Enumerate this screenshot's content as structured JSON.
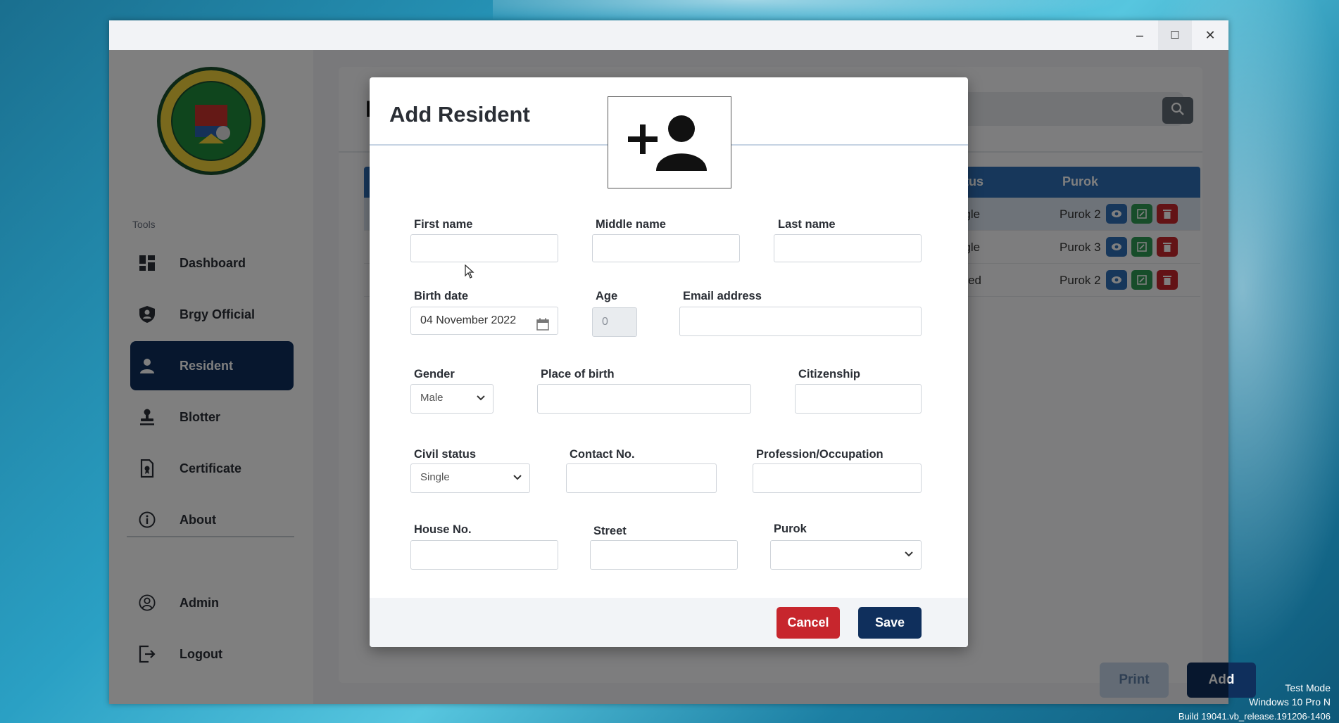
{
  "window": {
    "minimize_label": "–",
    "maximize_label": "☐",
    "close_label": "✕"
  },
  "sidebar": {
    "tools_label": "Tools",
    "items": [
      {
        "label": "Dashboard",
        "icon": "dashboard-icon"
      },
      {
        "label": "Brgy Official",
        "icon": "shield-user-icon"
      },
      {
        "label": "Resident",
        "icon": "user-icon",
        "active": true
      },
      {
        "label": "Blotter",
        "icon": "stamp-icon"
      },
      {
        "label": "Certificate",
        "icon": "certificate-icon"
      },
      {
        "label": "About",
        "icon": "info-icon"
      },
      {
        "label": "Admin",
        "icon": "admin-circle-icon"
      },
      {
        "label": "Logout",
        "icon": "logout-icon"
      }
    ]
  },
  "main": {
    "title_fragment": "I",
    "search_placeholder": "",
    "table": {
      "headers": [
        "atus",
        "Purok"
      ],
      "rows": [
        {
          "status": "ngle",
          "purok": "Purok 2"
        },
        {
          "status": "ngle",
          "purok": "Purok 3"
        },
        {
          "status": "rried",
          "purok": "Purok 2"
        }
      ]
    },
    "print_label": "Print",
    "add_label": "Add"
  },
  "modal": {
    "title": "Add Resident",
    "fields": {
      "first_name": {
        "label": "First name",
        "value": ""
      },
      "middle_name": {
        "label": "Middle name",
        "value": ""
      },
      "last_name": {
        "label": "Last name",
        "value": ""
      },
      "birth_date": {
        "label": "Birth date",
        "value": "04 November 2022"
      },
      "age": {
        "label": "Age",
        "value": "0"
      },
      "email": {
        "label": "Email address",
        "value": ""
      },
      "gender": {
        "label": "Gender",
        "value": "Male"
      },
      "place_of_birth": {
        "label": "Place of birth",
        "value": ""
      },
      "citizenship": {
        "label": "Citizenship",
        "value": ""
      },
      "civil_status": {
        "label": "Civil status",
        "value": "Single"
      },
      "contact_no": {
        "label": "Contact No.",
        "value": ""
      },
      "occupation": {
        "label": "Profession/Occupation",
        "value": ""
      },
      "house_no": {
        "label": "House No.",
        "value": ""
      },
      "street": {
        "label": "Street",
        "value": ""
      },
      "purok": {
        "label": "Purok",
        "value": ""
      }
    },
    "cancel_label": "Cancel",
    "save_label": "Save"
  },
  "os_watermark": {
    "line1": "Test Mode",
    "line2": "Windows 10 Pro N",
    "line3": "Build 19041.vb_release.191206-1406"
  },
  "colors": {
    "primary_navy": "#0f2f5c",
    "table_blue": "#2f6fb6",
    "danger_red": "#c7262d",
    "edit_green": "#2e9b54"
  }
}
